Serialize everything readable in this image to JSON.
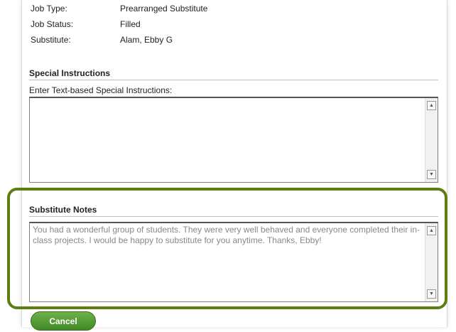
{
  "job_details": {
    "job_type_label": "Job Type:",
    "job_type_value": "Prearranged Substitute",
    "job_status_label": "Job Status:",
    "job_status_value": "Filled",
    "substitute_label": "Substitute:",
    "substitute_value": "Alam, Ebby G"
  },
  "special_instructions": {
    "title": "Special Instructions",
    "field_label": "Enter Text-based Special Instructions:",
    "value": ""
  },
  "substitute_notes": {
    "title": "Substitute Notes",
    "value": "You had a wonderful group of students. They were very well behaved and everyone completed their in-class projects. I would be happy to substitute for you anytime. Thanks, Ebby!"
  },
  "actions": {
    "cancel_label": "Cancel"
  },
  "colors": {
    "highlight_border": "#5d7f10",
    "button_green": "#4f9a30"
  }
}
